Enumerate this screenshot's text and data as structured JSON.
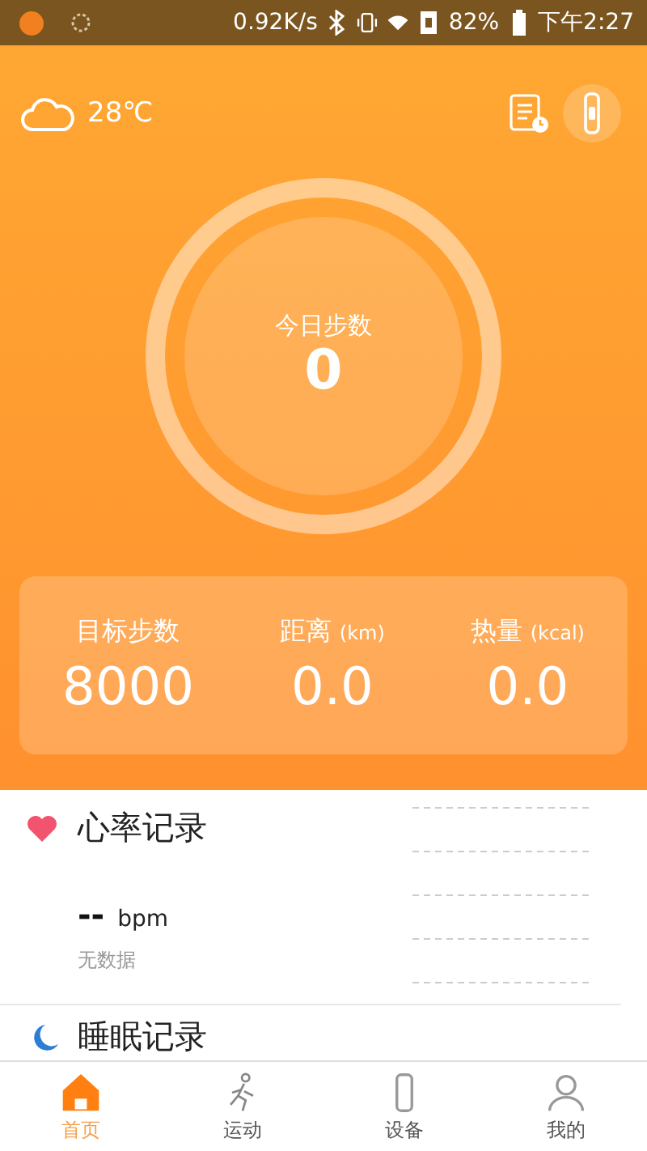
{
  "status_bar": {
    "speed": "0.92K/s",
    "battery": "82%",
    "time": "下午2:27"
  },
  "weather": {
    "temperature": "28℃"
  },
  "steps": {
    "label": "今日步数",
    "value": "0"
  },
  "stats": [
    {
      "label": "目标步数",
      "value": "8000"
    },
    {
      "label": "距离",
      "unit": "(km)",
      "value": "0.0"
    },
    {
      "label": "热量",
      "unit": "(kcal)",
      "value": "0.0"
    }
  ],
  "heart": {
    "title": "心率记录",
    "value": "--",
    "unit": "bpm",
    "note": "无数据"
  },
  "sleep": {
    "title": "睡眠记录"
  },
  "tabs": [
    {
      "label": "首页",
      "kind": "home",
      "selected": true
    },
    {
      "label": "运动",
      "kind": "sport",
      "selected": false
    },
    {
      "label": "设备",
      "kind": "device",
      "selected": false
    },
    {
      "label": "我的",
      "kind": "me",
      "selected": false
    }
  ]
}
